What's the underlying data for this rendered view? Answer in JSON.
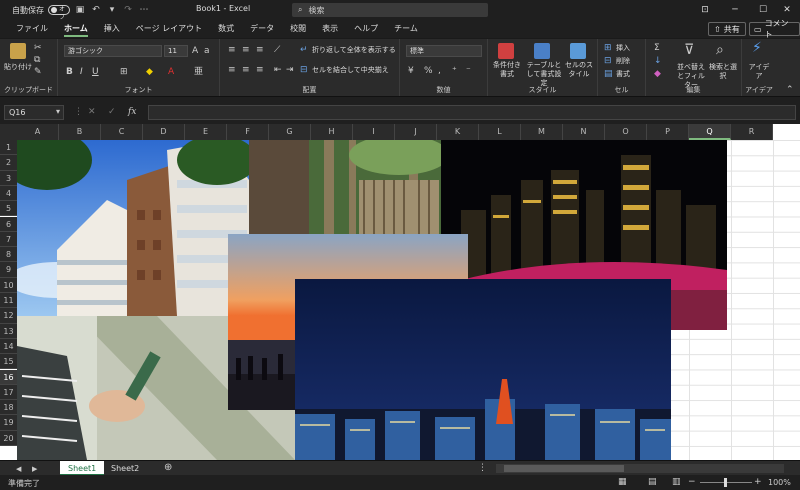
{
  "titlebar": {
    "autosave_label": "自動保存",
    "autosave_state": "オフ",
    "doc_title": "Book1  -  Excel",
    "search_placeholder": "検索",
    "share": "共有",
    "comment": "コメント"
  },
  "tabs": [
    "ファイル",
    "ホーム",
    "挿入",
    "ページ レイアウト",
    "数式",
    "データ",
    "校閲",
    "表示",
    "ヘルプ",
    "チーム"
  ],
  "active_tab": "ホーム",
  "ribbon": {
    "clipboard": {
      "paste": "貼り付け",
      "label": "クリップボード"
    },
    "font": {
      "name": "游ゴシック",
      "size": "11",
      "label": "フォント"
    },
    "alignment": {
      "wrap": "折り返して全体を表示する",
      "merge": "セルを結合して中央揃え",
      "label": "配置"
    },
    "number": {
      "format": "標準",
      "label": "数値"
    },
    "styles": {
      "conditional": "条件付き書式",
      "table": "テーブルとして書式設定",
      "cell": "セルのスタイル",
      "label": "スタイル"
    },
    "cells": {
      "insert": "挿入",
      "delete": "削除",
      "format": "書式",
      "label": "セル"
    },
    "editing": {
      "sort": "並べ替えとフィルター",
      "find": "検索と選択",
      "label": "編集"
    },
    "ideas": {
      "ideas": "アイデア",
      "label": "アイデア"
    }
  },
  "formula": {
    "namebox": "Q16",
    "value": ""
  },
  "columns": [
    "A",
    "B",
    "C",
    "D",
    "E",
    "F",
    "G",
    "H",
    "I",
    "J",
    "K",
    "L",
    "M",
    "N",
    "O",
    "P",
    "Q",
    "R"
  ],
  "rows": [
    "1",
    "2",
    "3",
    "4",
    "5",
    "6",
    "7",
    "8",
    "9",
    "10",
    "11",
    "12",
    "13",
    "14",
    "15",
    "16",
    "17",
    "18",
    "19",
    "20"
  ],
  "selected_column": "Q",
  "selected_row": "16",
  "sheets": [
    "Sheet1",
    "Sheet2"
  ],
  "active_sheet": "Sheet1",
  "status": {
    "ready": "準備完了",
    "zoom": "100%"
  }
}
